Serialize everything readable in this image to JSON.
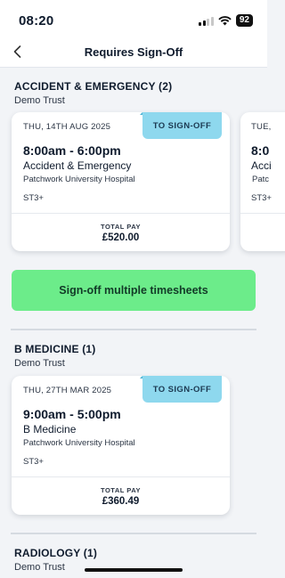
{
  "status_bar": {
    "time": "08:20",
    "battery": "92",
    "icons": [
      "signal-icon",
      "wifi-icon",
      "battery-icon"
    ]
  },
  "header": {
    "title": "Requires Sign-Off",
    "back_icon": "chevron-left-icon"
  },
  "sections": [
    {
      "title": "ACCIDENT & EMERGENCY (2)",
      "subtitle": "Demo Trust",
      "cards": [
        {
          "date": "THU, 14TH AUG 2025",
          "badge": "TO SIGN-OFF",
          "time": "8:00am - 6:00pm",
          "department": "Accident & Emergency",
          "hospital": "Patchwork University Hospital",
          "grade": "ST3+",
          "pay_label": "TOTAL PAY",
          "pay": "£520.00"
        },
        {
          "date": "TUE,",
          "time": "8:0",
          "department": "Acci",
          "hospital": "Patc",
          "grade": "ST3+"
        }
      ]
    },
    {
      "title": "B MEDICINE (1)",
      "subtitle": "Demo Trust",
      "cards": [
        {
          "date": "THU, 27TH MAR 2025",
          "badge": "TO SIGN-OFF",
          "time": "9:00am - 5:00pm",
          "department": "B Medicine",
          "hospital": "Patchwork University Hospital",
          "grade": "ST3+",
          "pay_label": "TOTAL PAY",
          "pay": "£360.49"
        }
      ]
    },
    {
      "title": "RADIOLOGY (1)",
      "subtitle": "Demo Trust"
    }
  ],
  "actions": {
    "signoff_multiple": "Sign-off multiple timesheets"
  },
  "colors": {
    "badge": "#8ed8ee",
    "primary_button": "#6cec8a",
    "background": "#f2f4f7"
  }
}
